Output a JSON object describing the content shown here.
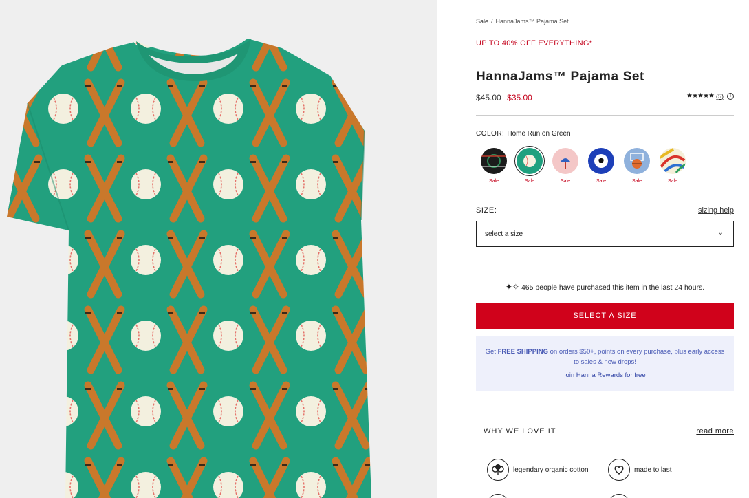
{
  "breadcrumb": {
    "parent": "Sale",
    "separator": "/",
    "current": "HannaJams™ Pajama Set"
  },
  "promo": "UP TO 40% OFF EVERYTHING*",
  "product": {
    "title": "HannaJams™ Pajama Set",
    "price_original": "$45.00",
    "price_sale": "$35.00",
    "rating_stars": "★★★★★",
    "rating_value": 4.5,
    "review_count": "(5)"
  },
  "color": {
    "label": "COLOR:",
    "selected": "Home Run on Green",
    "swatches": [
      {
        "name": "sports-on-black",
        "tag": "Sale",
        "colors": [
          "#1b1b1b",
          "#2e8b57"
        ]
      },
      {
        "name": "home-run-on-green",
        "tag": "Sale",
        "colors": [
          "#1fa07f",
          "#f5f1e1"
        ],
        "selected": true
      },
      {
        "name": "pink-print",
        "tag": "Sale",
        "colors": [
          "#f4c7c7",
          "#3060c0"
        ]
      },
      {
        "name": "soccer-on-blue",
        "tag": "Sale",
        "colors": [
          "#1d3fb8",
          "#ffffff"
        ]
      },
      {
        "name": "basketball-on-light-blue",
        "tag": "Sale",
        "colors": [
          "#8fb1dc",
          "#e06b2e"
        ]
      },
      {
        "name": "multicolor-stripe",
        "tag": "Sale",
        "colors": [
          "#f5efd9",
          "#d9342b"
        ]
      }
    ]
  },
  "size": {
    "label": "SIZE:",
    "help": "sizing help",
    "placeholder": "select a size"
  },
  "social_proof": "465 people have purchased this item in the last 24 hours.",
  "cta": "SELECT A SIZE",
  "rewards": {
    "prefix": "Get",
    "highlight": "FREE SHIPPING",
    "suffix": "on orders $50+, points on every purchase, plus early access",
    "line2": "to sales & new drops!",
    "link": "join Hanna Rewards for free"
  },
  "why": {
    "heading": "WHY WE LOVE IT",
    "read_more": "read more"
  },
  "features": [
    {
      "icon": "cotton-icon",
      "label": "legendary organic cotton"
    },
    {
      "icon": "heart-icon",
      "label": "made to last"
    }
  ],
  "colors": {
    "accent_red": "#d0021b",
    "sale_red": "#c4001a",
    "rewards_bg": "#eef0fb",
    "shirt_green": "#22a07e"
  }
}
